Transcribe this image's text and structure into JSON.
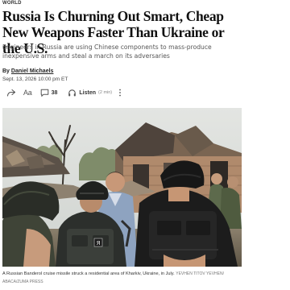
{
  "article": {
    "section": "World",
    "headline": "Russia Is Churning Out Smart, Cheap New Weapons Faster Than Ukraine or the U.S.",
    "dek": "Engineers in Russia are using Chinese components to mass-produce inexpensive arms and steal a march on its adversaries",
    "byline_prefix": "By",
    "author": "Daniel Michaels",
    "dateline": "Sept. 13, 2026 10:00 pm ET"
  },
  "toolbar": {
    "share_icon": "share-icon",
    "text_size_label": "Aa",
    "comment_icon": "comment-icon",
    "comment_count": "38",
    "listen_icon": "headphones-icon",
    "listen_label": "Listen",
    "listen_duration": "(2 min)",
    "more_icon": "more-vertical-icon"
  },
  "photo": {
    "caption": "A Russian Banderol cruise missile struck a residential area of Kharkiv, Ukraine, in July.",
    "credit": "YEVHEN TITOV YEVHEN/ ABACA/ZUMA PRESS",
    "patch_text": "Я"
  },
  "colors": {
    "text": "#111111",
    "dek": "#555555",
    "muted": "#777777",
    "sky": "#d6d9d6"
  }
}
